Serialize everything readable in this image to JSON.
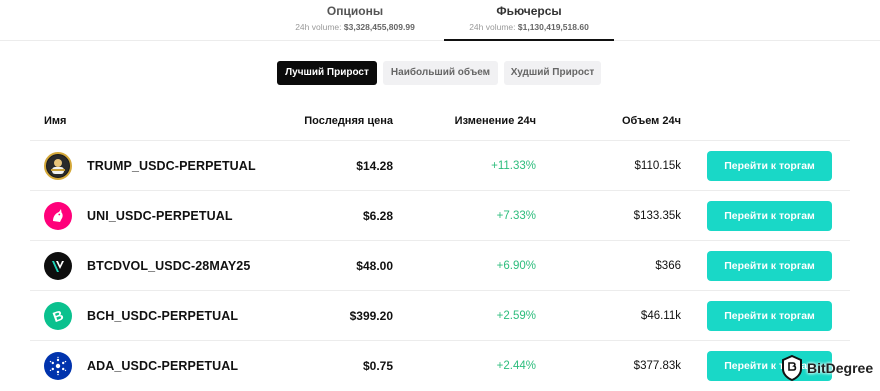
{
  "market_tabs": [
    {
      "label": "Опционы",
      "volume_label": "24h volume:",
      "volume_value": "$3,328,455,809.99"
    },
    {
      "label": "Фьючерсы",
      "volume_label": "24h volume:",
      "volume_value": "$1,130,419,518.60"
    }
  ],
  "active_market_tab": "Фьючерсы",
  "filters": [
    "Лучший Прирост",
    "Наибольший объем",
    "Худший Прирост"
  ],
  "active_filter": "Лучший Прирост",
  "columns": {
    "name": "Имя",
    "price": "Последняя цена",
    "change": "Изменение 24ч",
    "volume": "Объем 24ч"
  },
  "rows": [
    {
      "symbol": "TRUMP_USDC-PERPETUAL",
      "price": "$14.28",
      "change": "+11.33%",
      "volume": "$110.15k",
      "action": "Перейти к торгам",
      "icon": "trump-token-icon",
      "color": "#d4a83a"
    },
    {
      "symbol": "UNI_USDC-PERPETUAL",
      "price": "$6.28",
      "change": "+7.33%",
      "volume": "$133.35k",
      "action": "Перейти к торгам",
      "icon": "uniswap-unicorn-icon",
      "color": "#ff007a"
    },
    {
      "symbol": "BTCDVOL_USDC-28MAY25",
      "price": "$48.00",
      "change": "+6.90%",
      "volume": "$366",
      "action": "Перейти к торгам",
      "icon": "volatility-v-icon",
      "color": "#0e0e0e"
    },
    {
      "symbol": "BCH_USDC-PERPETUAL",
      "price": "$399.20",
      "change": "+2.59%",
      "volume": "$46.11k",
      "action": "Перейти к торгам",
      "icon": "bitcoin-cash-icon",
      "color": "#0ac18e"
    },
    {
      "symbol": "ADA_USDC-PERPETUAL",
      "price": "$0.75",
      "change": "+2.44%",
      "volume": "$377.83k",
      "action": "Перейти к торгам",
      "icon": "cardano-icon",
      "color": "#0033ad"
    }
  ],
  "colors": {
    "accent": "#19d8c7",
    "positive": "#2dbd7d",
    "active_chip": "#0b0b0b"
  },
  "watermark": {
    "text": "BitDegree",
    "icon": "bitdegree-shield-icon"
  }
}
